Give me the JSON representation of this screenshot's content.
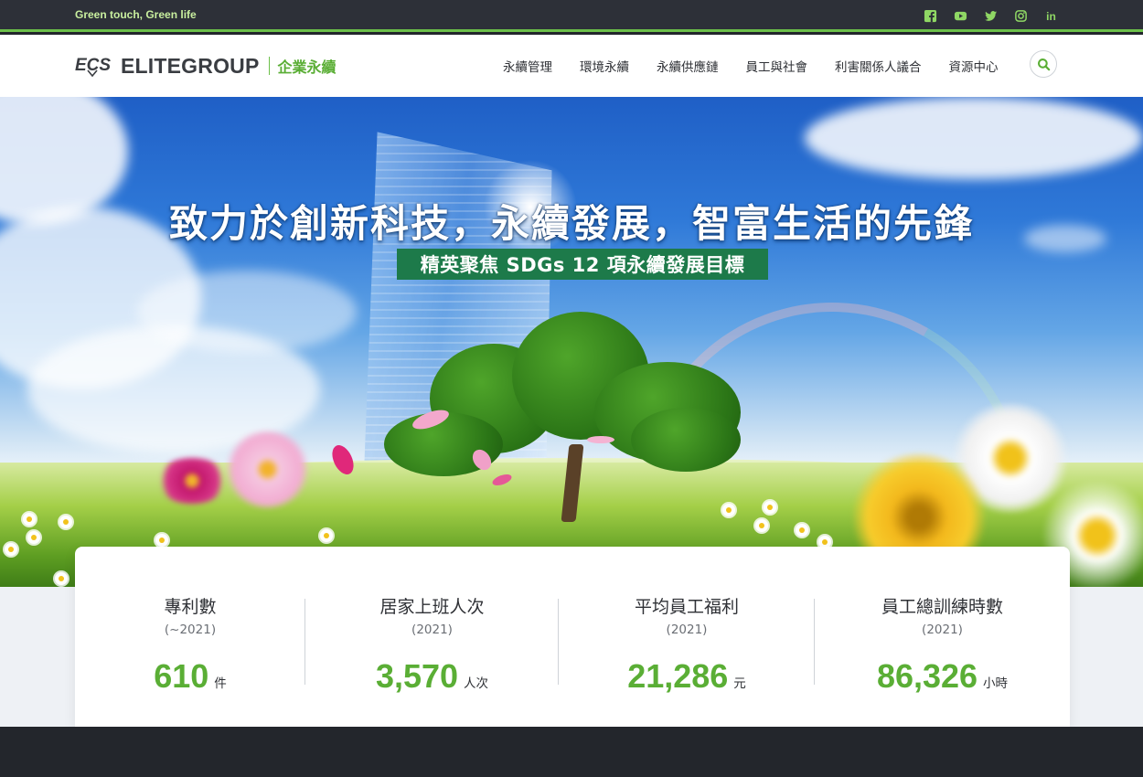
{
  "topbar": {
    "tagline": "Green touch, Green life",
    "social": [
      {
        "icon": "facebook-icon"
      },
      {
        "icon": "youtube-icon"
      },
      {
        "icon": "twitter-icon"
      },
      {
        "icon": "instagram-icon"
      },
      {
        "icon": "linkedin-icon",
        "text": "in"
      }
    ]
  },
  "header": {
    "logo_mark": "ECS",
    "logo_name": "ELITEGROUP",
    "logo_sub": "企業永續",
    "nav": [
      "永續管理",
      "環境永續",
      "永續供應鏈",
      "員工與社會",
      "利害關係人議合",
      "資源中心"
    ],
    "search_icon": "search-icon"
  },
  "hero": {
    "title": "致力於創新科技，永續發展，智富生活的先鋒",
    "subtitle": "精英聚焦 SDGs 12 項永續發展目標"
  },
  "stats": [
    {
      "label": "專利數",
      "year": "(~2021)",
      "value": "610",
      "unit": "件"
    },
    {
      "label": "居家上班人次",
      "year": "(2021)",
      "value": "3,570",
      "unit": "人次"
    },
    {
      "label": "平均員工福利",
      "year": "(2021)",
      "value": "21,286",
      "unit": "元"
    },
    {
      "label": "員工總訓練時數",
      "year": "(2021)",
      "value": "86,326",
      "unit": "小時"
    }
  ],
  "colors": {
    "accent": "#5aae35",
    "topbar": "#2d3038",
    "subtitle_bg": "#1d7a4a"
  }
}
